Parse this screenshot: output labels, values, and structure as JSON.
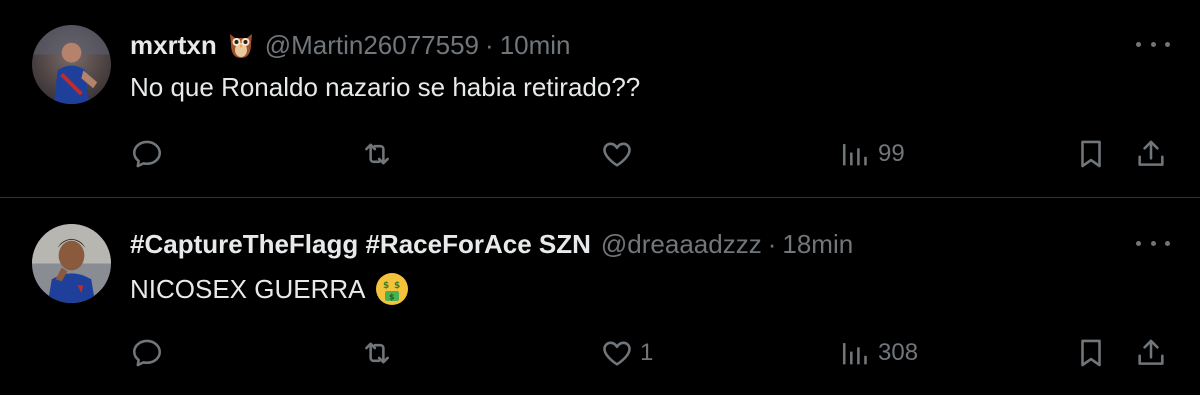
{
  "colors": {
    "background": "#000000",
    "text": "#e7e9ea",
    "secondary": "#71767b",
    "divider": "#2f3336"
  },
  "tweets": [
    {
      "name": "mxrtxn",
      "name_badge_icon": "owl-emoji",
      "handle": "@Martin26077559",
      "separator": "·",
      "time": "10min",
      "text": "No que Ronaldo nazario se habia retirado??",
      "views": "99",
      "likes": ""
    },
    {
      "name": "#CaptureTheFlagg #RaceForAce SZN",
      "handle": "@dreaaadzzz",
      "separator": "·",
      "time": "18min",
      "text": "NICOSEX GUERRA",
      "text_emoji_icon": "money-mouth-face-emoji",
      "views": "308",
      "likes": "1"
    }
  ]
}
